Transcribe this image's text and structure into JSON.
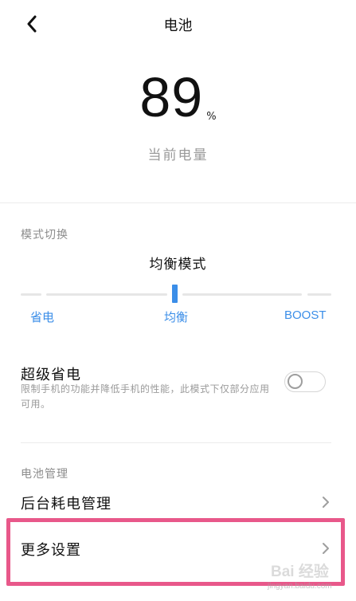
{
  "header": {
    "title": "电池",
    "back_icon": "chevron-left-icon"
  },
  "battery": {
    "level": "89",
    "unit": "%",
    "caption": "当前电量"
  },
  "mode": {
    "section_label": "模式切换",
    "current": "均衡模式",
    "options": [
      "省电",
      "均衡",
      "BOOST"
    ],
    "selected": "均衡",
    "accent_color": "#3b8ee8"
  },
  "super_saver": {
    "title": "超级省电",
    "description": "限制手机的功能并降低手机的性能，此模式下仅部分应用可用。",
    "enabled": false
  },
  "management": {
    "section_label": "电池管理",
    "items": [
      {
        "label": "后台耗电管理",
        "icon": "chevron-right-icon"
      },
      {
        "label": "更多设置",
        "icon": "chevron-right-icon"
      }
    ]
  },
  "highlight_color": "#e8588a",
  "watermark": {
    "text": "Bai 经验",
    "url": "jingyan.baidu.com"
  }
}
